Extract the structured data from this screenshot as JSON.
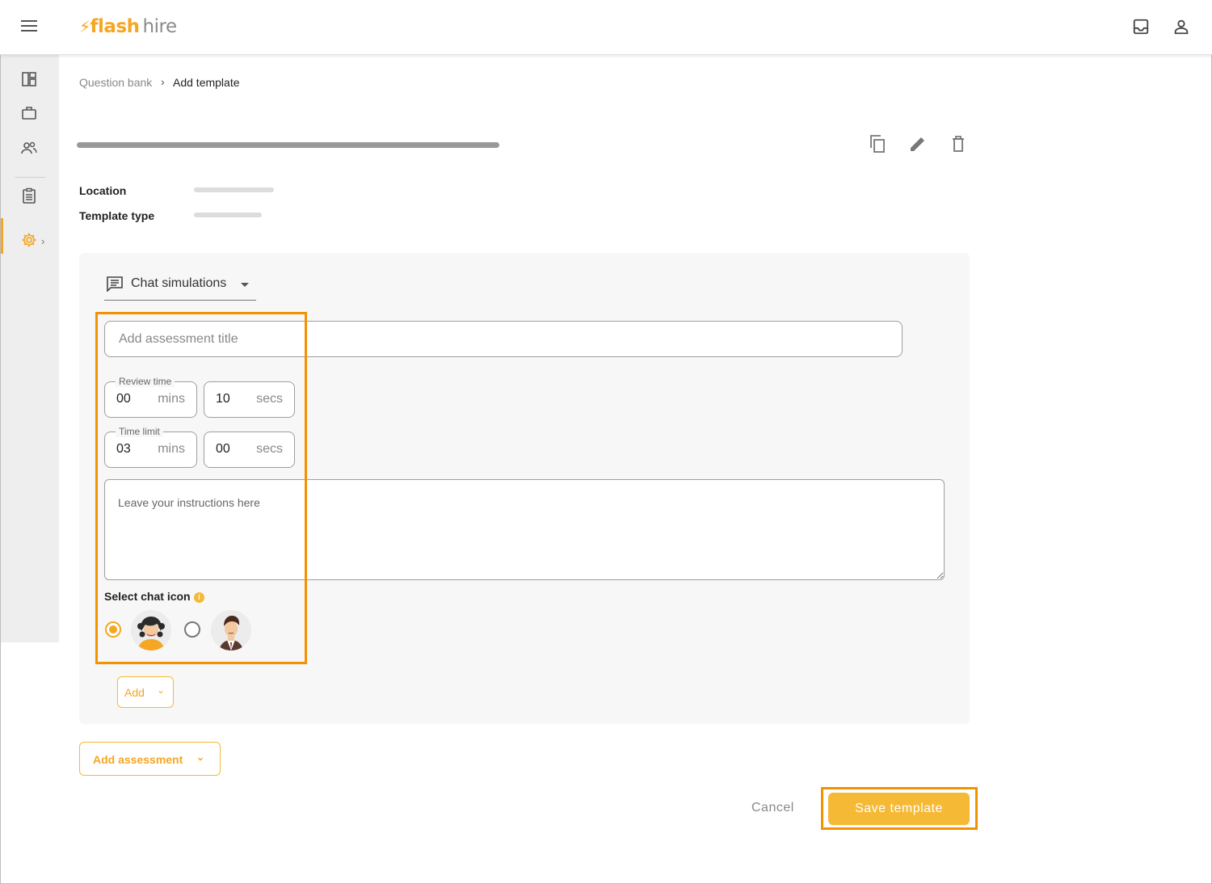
{
  "header": {
    "logo_flash": "flash",
    "logo_hire": "hire",
    "icons": [
      "menu-icon",
      "inbox-icon",
      "account-icon"
    ]
  },
  "sidebar": {
    "items": [
      {
        "icon": "dashboard-icon"
      },
      {
        "icon": "briefcase-icon"
      },
      {
        "icon": "people-icon"
      },
      {
        "icon": "clipboard-icon"
      },
      {
        "icon": "settings-icon",
        "active": true
      }
    ],
    "chevron": "›"
  },
  "breadcrumb": {
    "parent": "Question bank",
    "separator": "›",
    "current": "Add template"
  },
  "toolbar_icons": [
    "copy-icon",
    "edit-icon",
    "delete-icon"
  ],
  "meta": {
    "location_label": "Location",
    "template_type_label": "Template type"
  },
  "panel": {
    "type_selector": "Chat simulations",
    "title_placeholder": "Add assessment title",
    "review_time": {
      "label": "Review time",
      "mins": "00",
      "secs": "10"
    },
    "time_limit": {
      "label": "Time limit",
      "mins": "03",
      "secs": "00"
    },
    "mins_unit": "mins",
    "secs_unit": "secs",
    "instructions_placeholder": "Leave your instructions here",
    "select_chat_icon_label": "Select chat icon",
    "info_glyph": "i",
    "chat_icons": [
      {
        "name": "female-agent-avatar",
        "selected": true
      },
      {
        "name": "male-agent-avatar",
        "selected": false
      }
    ],
    "add_label": "Add",
    "chevron_glyph": "⌄"
  },
  "add_assessment_label": "Add assessment",
  "cancel_label": "Cancel",
  "save_label": "Save template",
  "colors": {
    "accent": "#f5a623",
    "highlight": "#f39200",
    "save_bg": "#f5b935"
  }
}
